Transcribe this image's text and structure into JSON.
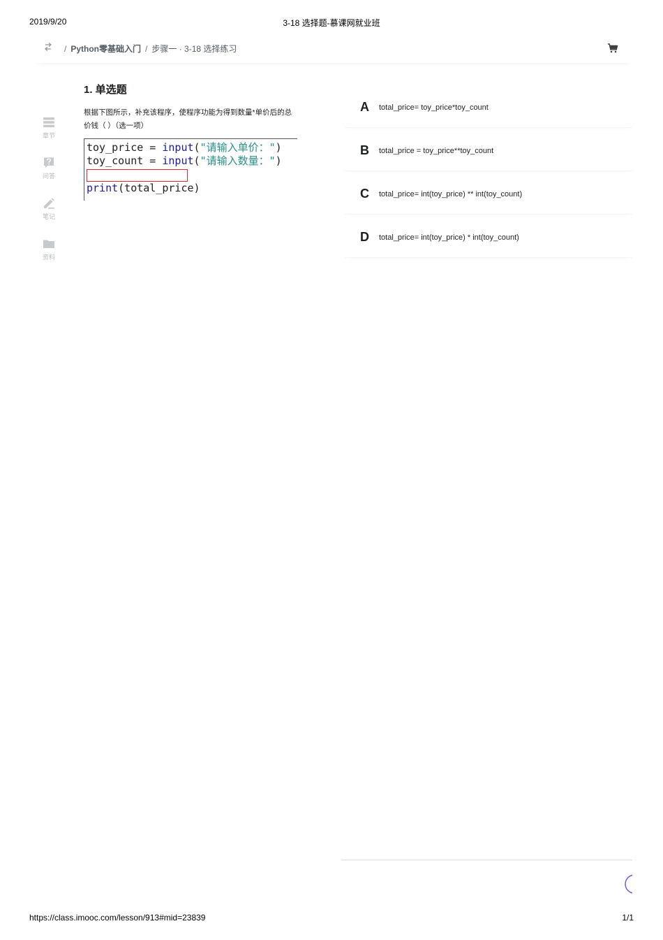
{
  "print": {
    "date": "2019/9/20",
    "title": "3-18 选择题-慕课网就业班",
    "url": "https://class.imooc.com/lesson/913#mid=23839",
    "pages": "1/1"
  },
  "header": {
    "separator": "/",
    "course": "Python零基础入门",
    "step": "步骤一 · 3-18 选择练习",
    "toggle_icon": "swap-icon",
    "cart_icon": "cart-icon"
  },
  "sidebar": {
    "items": [
      {
        "label": "章节",
        "icon": "chapters-icon"
      },
      {
        "label": "问答",
        "icon": "question-icon"
      },
      {
        "label": "笔记",
        "icon": "pencil-icon"
      },
      {
        "label": "资料",
        "icon": "folder-icon"
      }
    ]
  },
  "question": {
    "title": "1. 单选题",
    "text": "根据下图所示，补充该程序，使程序功能为得到数量*单价后的总价钱（ ）（选一项）",
    "code": {
      "line1": {
        "var": "toy_price = ",
        "fn": "input",
        "open": "(",
        "str": "\"请输入单价：\"",
        "close": ")"
      },
      "line2": {
        "var": "toy_count = ",
        "fn": "input",
        "open": "(",
        "str": "\"请输入数量：\"",
        "close": ")"
      },
      "line4": {
        "fn": "print",
        "rest": "(total_price)"
      }
    }
  },
  "options": [
    {
      "letter": "A",
      "text": "total_price= toy_price*toy_count"
    },
    {
      "letter": "B",
      "text": "total_price = toy_price**toy_count"
    },
    {
      "letter": "C",
      "text": "total_price= int(toy_price) ** int(toy_count)"
    },
    {
      "letter": "D",
      "text": "total_price= int(toy_price) * int(toy_count)"
    }
  ],
  "colors": {
    "accent": "#7b5bd6",
    "code_function": "#1a1aa6",
    "code_string": "#2a8f8a",
    "blank_highlight": "#e02a2a"
  }
}
